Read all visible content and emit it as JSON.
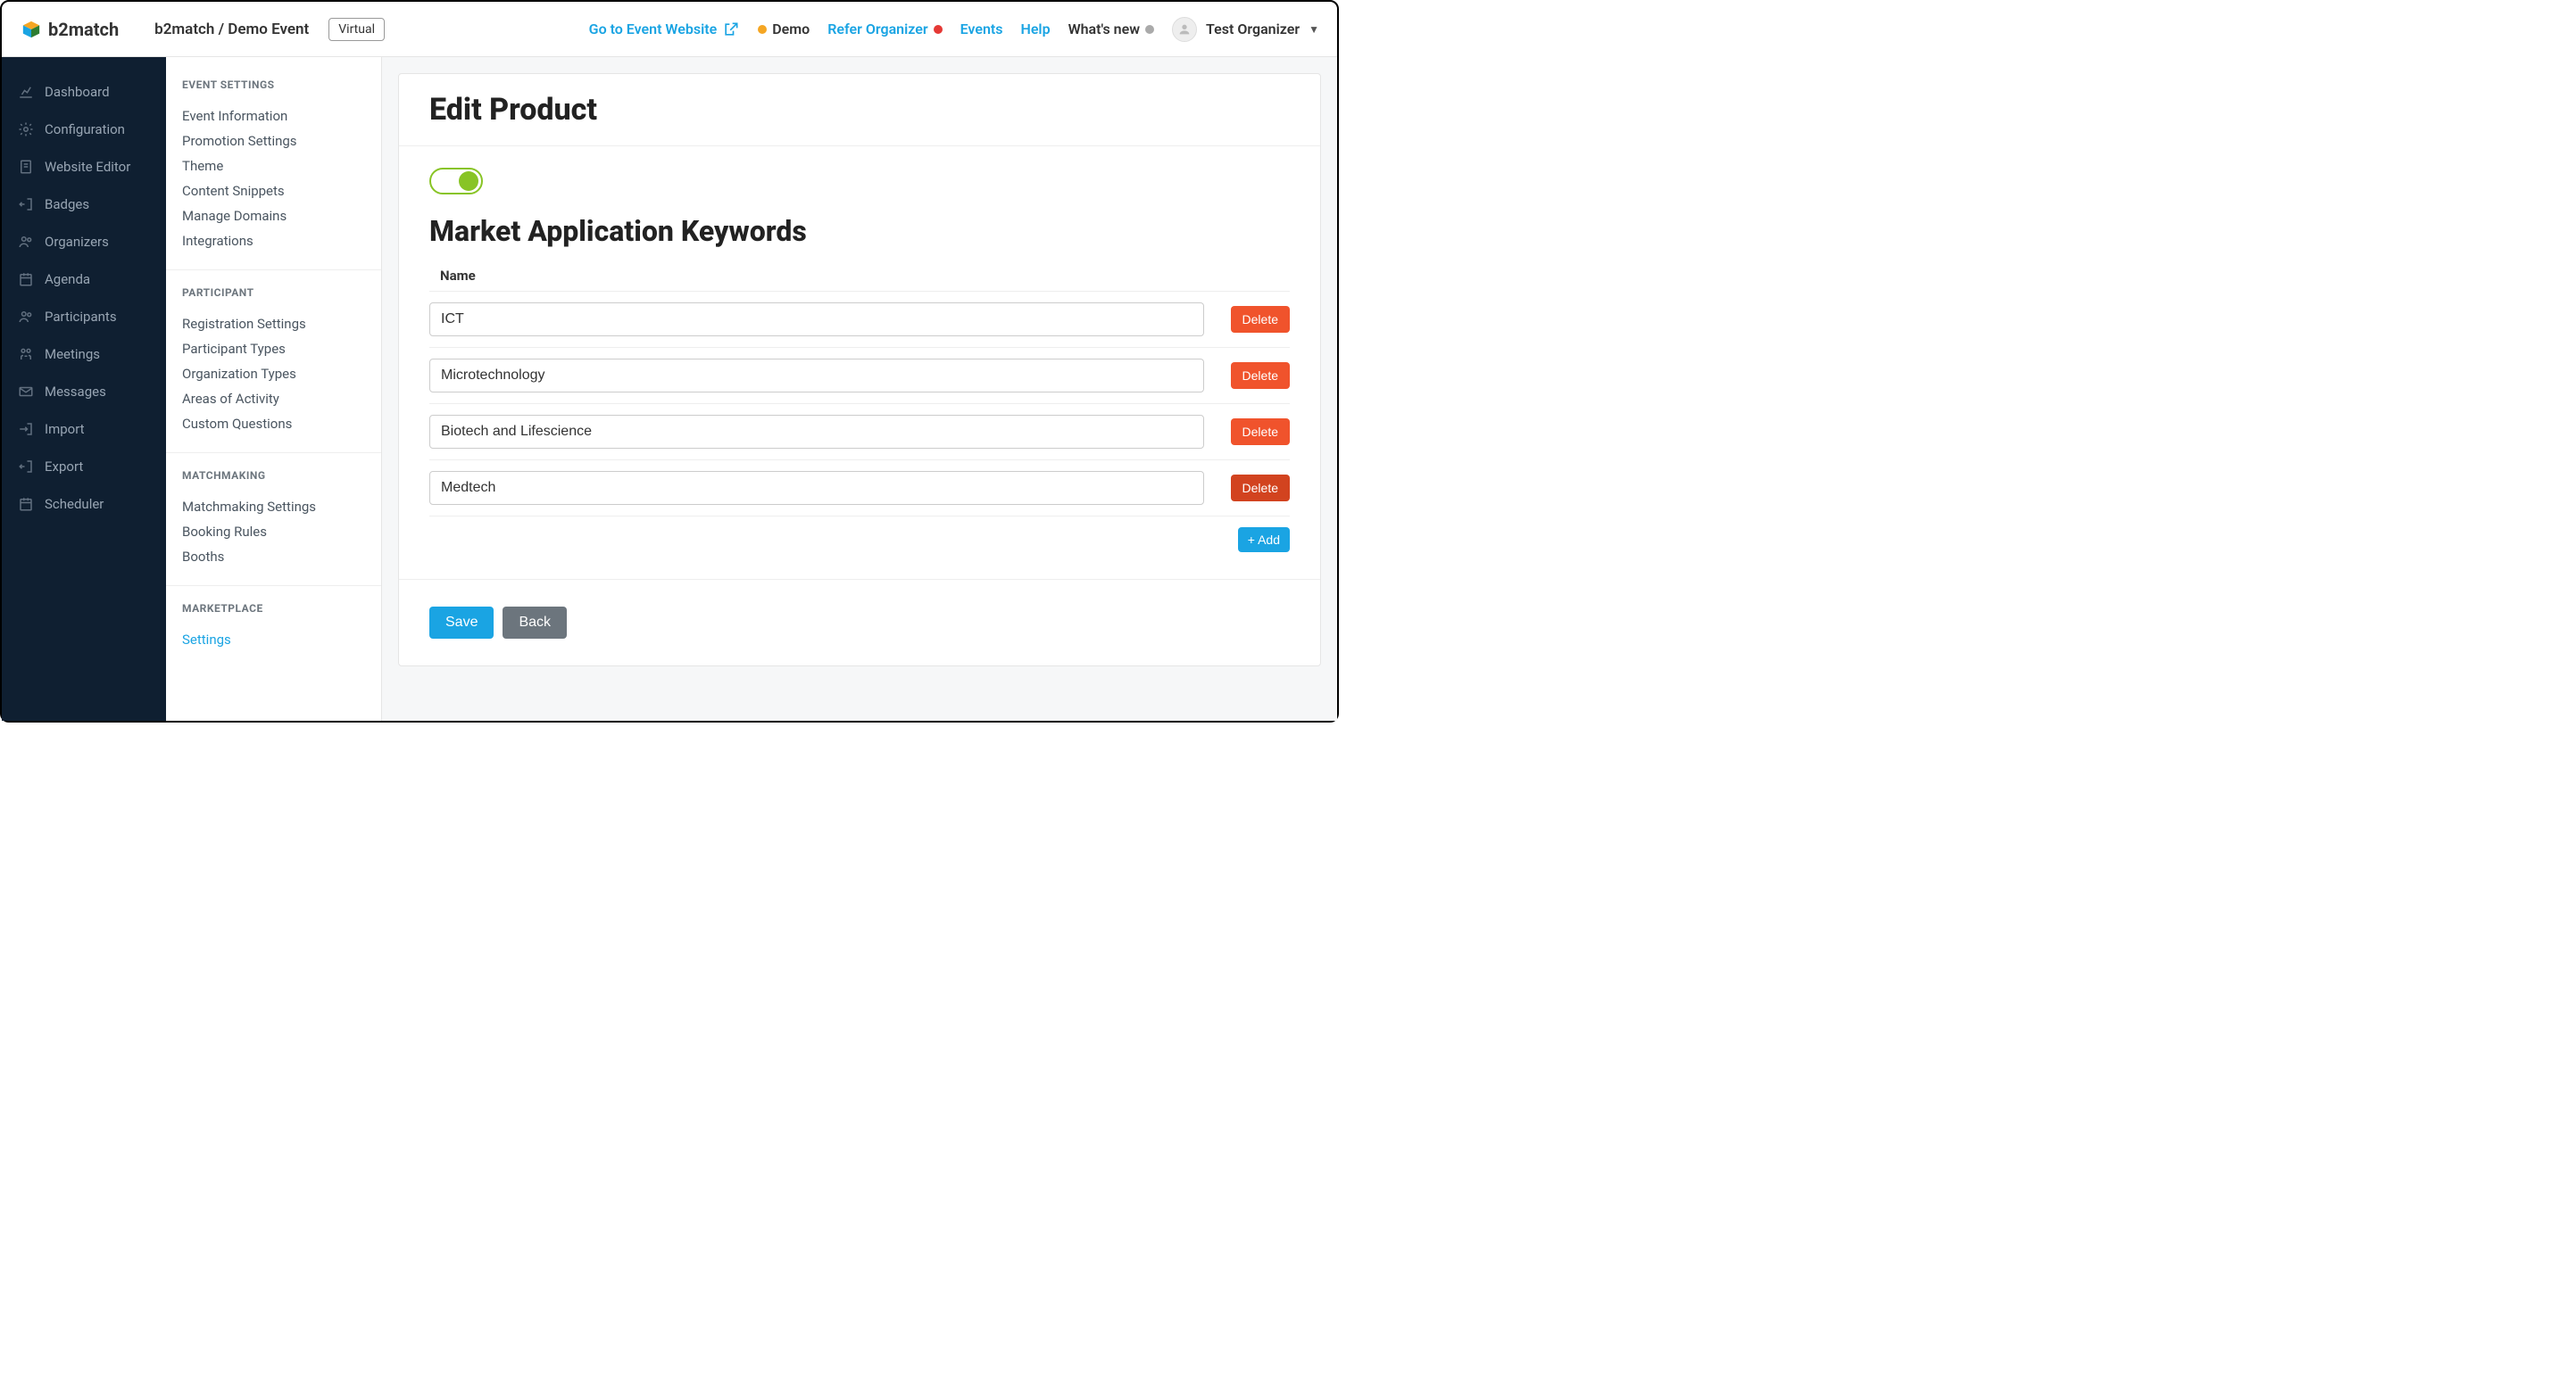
{
  "brand": "b2match",
  "breadcrumb": "b2match / Demo Event",
  "badge": "Virtual",
  "topnav": {
    "go_to_event": "Go to Event Website",
    "demo": "Demo",
    "refer": "Refer Organizer",
    "events": "Events",
    "help": "Help",
    "whats_new": "What's new",
    "user": "Test Organizer"
  },
  "sidebar": {
    "items": [
      "Dashboard",
      "Configuration",
      "Website Editor",
      "Badges",
      "Organizers",
      "Agenda",
      "Participants",
      "Meetings",
      "Messages",
      "Import",
      "Export",
      "Scheduler"
    ]
  },
  "subnav": {
    "event_settings": {
      "header": "EVENT SETTINGS",
      "items": [
        "Event Information",
        "Promotion Settings",
        "Theme",
        "Content Snippets",
        "Manage Domains",
        "Integrations"
      ]
    },
    "participant": {
      "header": "PARTICIPANT",
      "items": [
        "Registration Settings",
        "Participant Types",
        "Organization Types",
        "Areas of Activity",
        "Custom Questions"
      ]
    },
    "matchmaking": {
      "header": "MATCHMAKING",
      "items": [
        "Matchmaking Settings",
        "Booking Rules",
        "Booths"
      ]
    },
    "marketplace": {
      "header": "MARKETPLACE",
      "items": [
        "Settings"
      ]
    }
  },
  "main": {
    "title": "Edit Product",
    "section": "Market Application Keywords",
    "column_header": "Name",
    "rows": [
      {
        "value": "ICT",
        "delete": "Delete"
      },
      {
        "value": "Microtechnology",
        "delete": "Delete"
      },
      {
        "value": "Biotech and Lifescience",
        "delete": "Delete"
      },
      {
        "value": "Medtech",
        "delete": "Delete"
      }
    ],
    "add": "+ Add",
    "save": "Save",
    "back": "Back"
  }
}
